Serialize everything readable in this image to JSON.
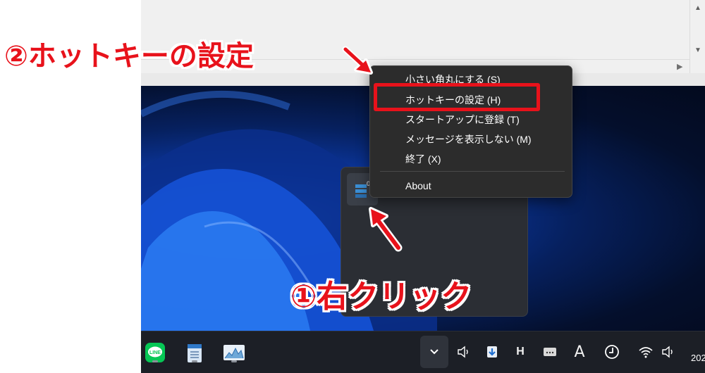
{
  "annotations": {
    "step2": "②ホットキーの設定",
    "step1": "①右クリック"
  },
  "context_menu": {
    "items": [
      {
        "label": "小さい角丸にする (S)"
      },
      {
        "label": "ホットキーの設定 (H)"
      },
      {
        "label": "スタートアップに登録 (T)"
      },
      {
        "label": "メッセージを表示しない (M)"
      },
      {
        "label": "終了 (X)"
      },
      {
        "label": "About"
      }
    ],
    "highlighted_index": 1
  },
  "tray_flyout": {
    "icon": "corner-app-tray-icon",
    "badge": "0"
  },
  "taskbar": {
    "apps": [
      {
        "name": "LINE",
        "icon": "line-app-icon",
        "color": "#06c755"
      },
      {
        "name": "Notepad",
        "icon": "notepad-icon",
        "color": "#2f78c8"
      },
      {
        "name": "Resource monitor",
        "icon": "chart-app-icon",
        "color": "#6ea8d8"
      }
    ],
    "tray": {
      "chevron_icon": "chevron-down-icon",
      "h_label": "H",
      "a_label": "A"
    },
    "clock_fragment": "202"
  },
  "colors": {
    "annotation_red": "#e8121b",
    "menu_bg": "#2c2c2c",
    "taskbar_bg": "#1c1f26"
  }
}
